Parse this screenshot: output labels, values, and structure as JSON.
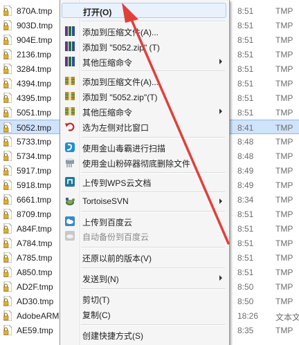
{
  "files": [
    {
      "name": "870A.tmp",
      "time": "8:51",
      "type": "TMP"
    },
    {
      "name": "903D.tmp",
      "time": "8:51",
      "type": "TMP"
    },
    {
      "name": "904E.tmp",
      "time": "8:51",
      "type": "TMP"
    },
    {
      "name": "2136.tmp",
      "time": "8:51",
      "type": "TMP"
    },
    {
      "name": "3284.tmp",
      "time": "8:51",
      "type": "TMP"
    },
    {
      "name": "4394.tmp",
      "time": "8:51",
      "type": "TMP"
    },
    {
      "name": "4395.tmp",
      "time": "8:51",
      "type": "TMP"
    },
    {
      "name": "5051.tmp",
      "time": "8:51",
      "type": "TMP"
    },
    {
      "name": "5052.tmp",
      "time": "8:41",
      "type": "TMP"
    },
    {
      "name": "5733.tmp",
      "time": "8:48",
      "type": "TMP"
    },
    {
      "name": "5734.tmp",
      "time": "8:48",
      "type": "TMP"
    },
    {
      "name": "5917.tmp",
      "time": "8:49",
      "type": "TMP"
    },
    {
      "name": "5918.tmp",
      "time": "8:49",
      "type": "TMP"
    },
    {
      "name": "6661.tmp",
      "time": "8:34",
      "type": "TMP"
    },
    {
      "name": "8709.tmp",
      "time": "8:51",
      "type": "TMP"
    },
    {
      "name": "A84F.tmp",
      "time": "8:51",
      "type": "TMP"
    },
    {
      "name": "A784.tmp",
      "time": "8:51",
      "type": "TMP"
    },
    {
      "name": "A785.tmp",
      "time": "8:51",
      "type": "TMP"
    },
    {
      "name": "A850.tmp",
      "time": "8:51",
      "type": "TMP"
    },
    {
      "name": "AD2F.tmp",
      "time": "8:50",
      "type": "TMP"
    },
    {
      "name": "AD30.tmp",
      "time": "8:50",
      "type": "TMP"
    },
    {
      "name": "AdobeARM",
      "time": "18:26",
      "type": "文本文"
    },
    {
      "name": "AE59.tmp",
      "time": "8:35",
      "type": "TMP"
    }
  ],
  "selected_file": "5052.tmp",
  "context_menu": {
    "open": "打开(O)",
    "add_archive_1": "添加到压缩文件(A)...",
    "add_zip_1": "添加到 \"5052.zip\" (T)",
    "other_compress_1": "其他压缩命令",
    "add_archive_2": "添加到压缩文件(A)...",
    "add_zip_2": "添加到 \"5052.zip\"(T)",
    "other_compress_2": "其他压缩命令",
    "compare_left": "选为左侧对比窗口",
    "kingsoft_scan": "使用金山毒霸进行扫描",
    "kingsoft_shred": "使用金山粉碎器彻底删除文件",
    "wps_upload": "上传到WPS云文档",
    "tortoise": "TortoiseSVN",
    "baidu_upload": "上传到百度云",
    "baidu_backup": "自动备份到百度云",
    "restore": "还原以前的版本(V)",
    "send_to": "发送到(N)",
    "cut": "剪切(T)",
    "copy": "复制(C)",
    "shortcut": "创建快捷方式(S)"
  },
  "colors": {
    "annotation_arrow": "#e0403a",
    "selection": "#cfe3fb"
  }
}
